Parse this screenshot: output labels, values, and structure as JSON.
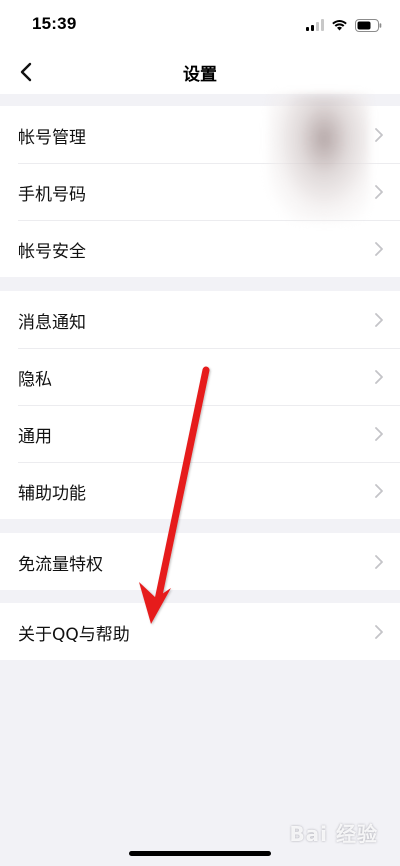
{
  "status_bar": {
    "time": "15:39",
    "icons": [
      "cellular-signal-icon",
      "wifi-icon",
      "battery-icon"
    ]
  },
  "nav": {
    "title": "设置",
    "back_icon": "chevron-left-icon"
  },
  "groups": [
    {
      "items": [
        {
          "label": "帐号管理"
        },
        {
          "label": "手机号码"
        },
        {
          "label": "帐号安全"
        }
      ]
    },
    {
      "items": [
        {
          "label": "消息通知"
        },
        {
          "label": "隐私"
        },
        {
          "label": "通用"
        },
        {
          "label": "辅助功能"
        }
      ]
    },
    {
      "items": [
        {
          "label": "免流量特权"
        }
      ]
    },
    {
      "items": [
        {
          "label": "关于QQ与帮助"
        }
      ]
    }
  ],
  "annotation": {
    "color": "#e61e1e"
  },
  "watermark": {
    "text": "Bai 经验"
  },
  "colors": {
    "background": "#f2f2f6",
    "surface": "#ffffff",
    "separator": "#ececef",
    "chevron": "#c4c4c8"
  }
}
